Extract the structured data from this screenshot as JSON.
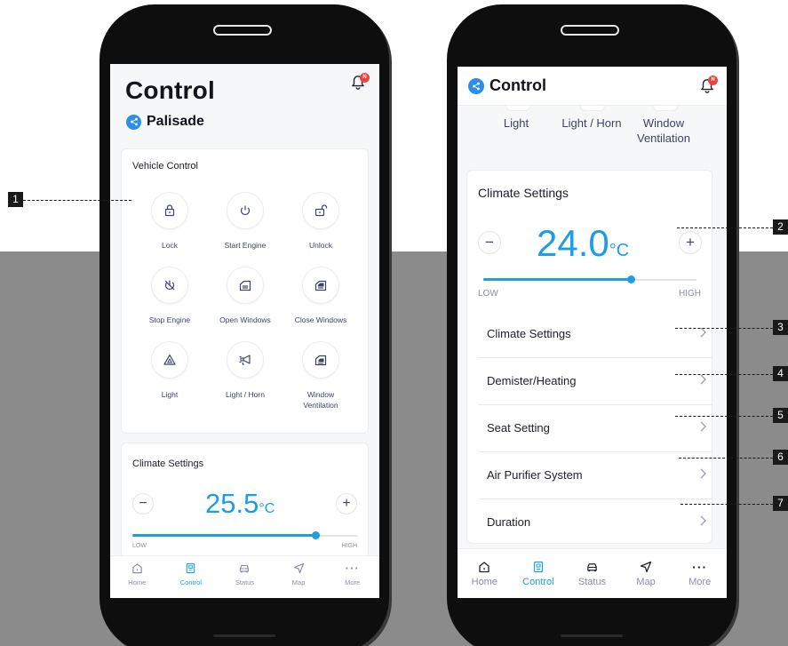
{
  "left_screen": {
    "title": "Control",
    "car_name": "Palisade",
    "notification_badge": "N",
    "vehicle_control": {
      "title": "Vehicle Control",
      "buttons": [
        {
          "label": "Lock",
          "icon": "lock-icon"
        },
        {
          "label": "Start Engine",
          "icon": "power-icon"
        },
        {
          "label": "Unlock",
          "icon": "unlock-icon"
        },
        {
          "label": "Stop Engine",
          "icon": "stop-engine-icon"
        },
        {
          "label": "Open Windows",
          "icon": "open-window-icon"
        },
        {
          "label": "Close Windows",
          "icon": "close-window-icon"
        },
        {
          "label": "Light",
          "icon": "hazard-triangle-icon"
        },
        {
          "label": "Light / Horn",
          "icon": "horn-icon"
        },
        {
          "label": "Window\nVentilation",
          "icon": "window-vent-icon"
        }
      ]
    },
    "climate": {
      "title": "Climate Settings",
      "temp": "25.5",
      "unit": "°C",
      "slider_fraction": 0.81,
      "low_label": "LOW",
      "high_label": "HIGH"
    }
  },
  "right_screen": {
    "title": "Control",
    "notification_badge": "N",
    "top_controls": [
      {
        "label": "Light"
      },
      {
        "label": "Light / Horn"
      },
      {
        "label": "Window\nVentilation"
      }
    ],
    "climate": {
      "title": "Climate Settings",
      "temp": "24.0",
      "unit": "°C",
      "slider_fraction": 0.69,
      "low_label": "LOW",
      "high_label": "HIGH"
    },
    "menu": [
      {
        "label": "Climate Settings"
      },
      {
        "label": "Demister/Heating"
      },
      {
        "label": "Seat Setting"
      },
      {
        "label": "Air Purifier System"
      },
      {
        "label": "Duration"
      }
    ]
  },
  "tabs": [
    {
      "label": "Home",
      "icon": "home-icon"
    },
    {
      "label": "Control",
      "icon": "control-icon"
    },
    {
      "label": "Status",
      "icon": "car-status-icon"
    },
    {
      "label": "Map",
      "icon": "map-arrow-icon"
    },
    {
      "label": "More",
      "icon": "more-dots-icon"
    }
  ],
  "callouts": [
    "1",
    "2",
    "3",
    "4",
    "5",
    "6",
    "7"
  ],
  "colors": {
    "accent": "#1c9de8",
    "share_blue": "#2b8ee9",
    "badge_red": "#e7453f",
    "callout_black": "#1a1a1a",
    "background_grey": "#8b8b8b"
  }
}
